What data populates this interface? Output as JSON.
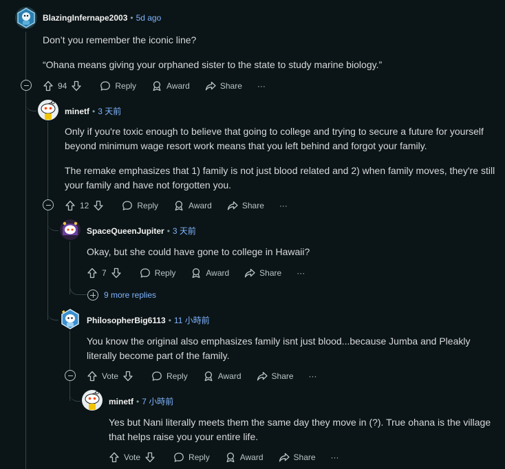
{
  "comments": [
    {
      "author": "BlazingInfernape2003",
      "time": "5d ago",
      "paragraphs": [
        "Don’t you remember the iconic line?",
        "“Ohana means giving your orphaned sister to the state to study marine biology.”"
      ],
      "votes": "94",
      "actions": {
        "reply": "Reply",
        "award": "Award",
        "share": "Share",
        "more": "···"
      }
    },
    {
      "author": "minetf",
      "time": "3 天前",
      "paragraphs": [
        "Only if you're toxic enough to believe that going to college and trying to secure a future for yourself beyond minimum wage resort work means that you left behind and forgot your family.",
        "The remake emphasizes that 1) family is not just blood related and 2) when family moves, they're still your family and have not forgotten you."
      ],
      "votes": "12",
      "actions": {
        "reply": "Reply",
        "award": "Award",
        "share": "Share",
        "more": "···"
      }
    },
    {
      "author": "SpaceQueenJupiter",
      "time": "3 天前",
      "paragraphs": [
        "Okay, but she could have gone to college in Hawaii?"
      ],
      "votes": "7",
      "actions": {
        "reply": "Reply",
        "award": "Award",
        "share": "Share",
        "more": "···"
      },
      "more_replies": "9 more replies"
    },
    {
      "author": "PhilosopherBig6113",
      "time": "11 小時前",
      "paragraphs": [
        "You know the original also emphasizes family isnt just blood...because Jumba and Pleakly literally become part of the family."
      ],
      "votes": "Vote",
      "actions": {
        "reply": "Reply",
        "award": "Award",
        "share": "Share",
        "more": "···"
      }
    },
    {
      "author": "minetf",
      "time": "7 小時前",
      "paragraphs": [
        "Yes but Nani literally meets them the same day they move in (?). True ohana is the village that helps raise you your entire life."
      ],
      "votes": "Vote",
      "actions": {
        "reply": "Reply",
        "award": "Award",
        "share": "Share",
        "more": "···"
      }
    }
  ],
  "separator": "•",
  "icons": {
    "upvote": "upvote-arrow-icon",
    "downvote": "downvote-arrow-icon",
    "reply": "speech-bubble-icon",
    "award": "award-ribbon-icon",
    "share": "share-arrow-icon",
    "collapse": "minus-circle-icon",
    "expand": "plus-circle-icon"
  }
}
